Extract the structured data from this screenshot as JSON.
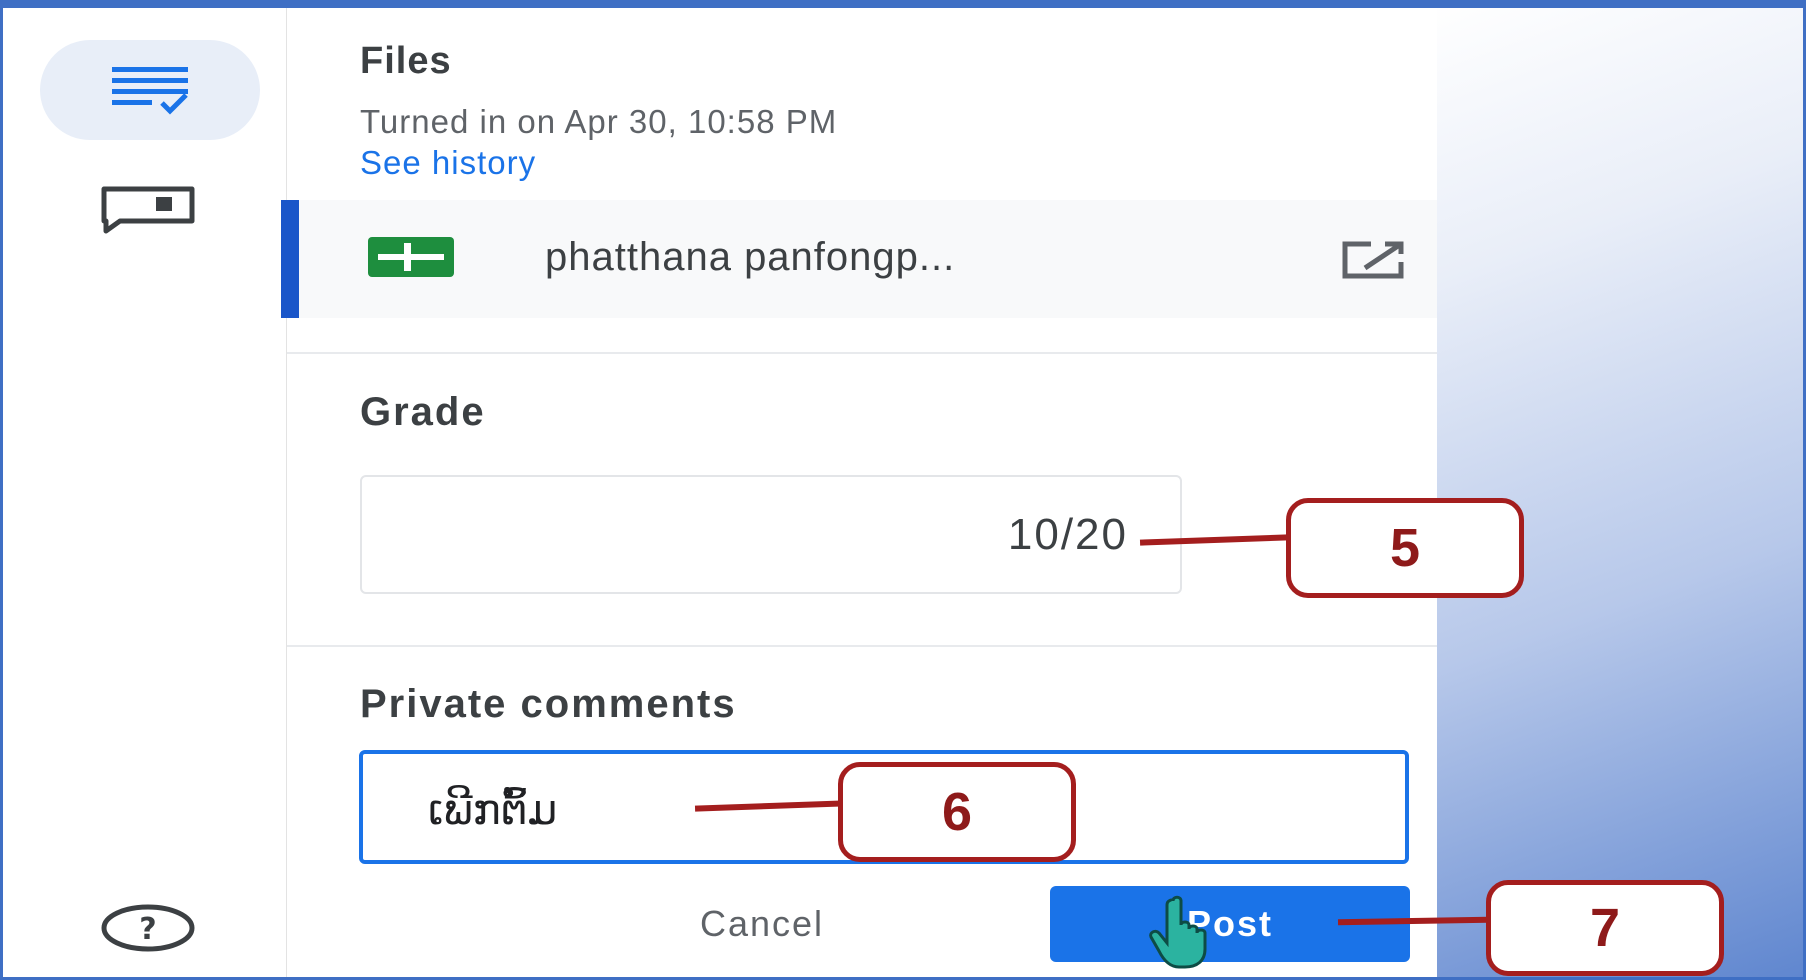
{
  "files": {
    "title": "Files",
    "turned_in": "Turned in on Apr 30, 10:58 PM",
    "see_history": "See history",
    "file_name": "phatthana panfongp...",
    "file_icon": "sheets-icon",
    "open_icon": "open-in-new-icon"
  },
  "grade": {
    "title": "Grade",
    "value": "10/20"
  },
  "private_comments": {
    "title": "Private comments",
    "value": "ເພີກຕົ້ມ"
  },
  "actions": {
    "cancel_label": "Cancel",
    "post_label": "Post"
  },
  "callouts": {
    "grade": "5",
    "comment": "6",
    "post": "7"
  },
  "colors": {
    "accent": "#1a73e8",
    "callout": "#a41e1e",
    "sheets_green": "#1e8e3e"
  }
}
